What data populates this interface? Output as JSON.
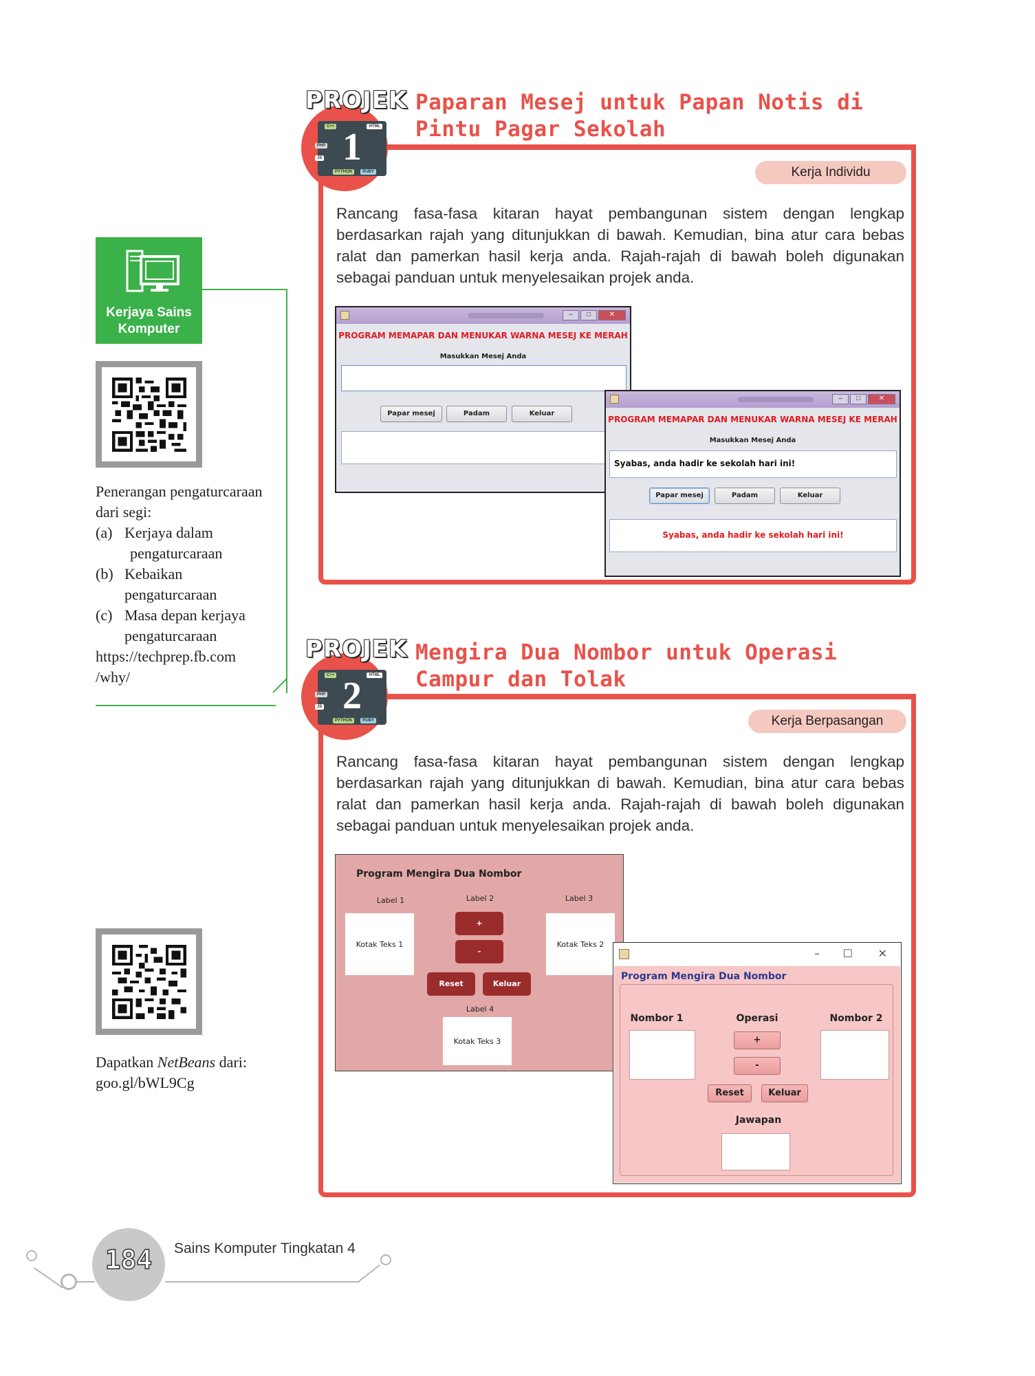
{
  "sidebar": {
    "career_badge": "Kerjaya Sains Komputer",
    "programming_note": {
      "intro_line1": "Penerangan pengaturcaraan",
      "intro_line2": "dari segi:",
      "items": [
        {
          "mark": "(a)",
          "line1": "Kerjaya dalam",
          "line2": "pengaturcaraan"
        },
        {
          "mark": "(b)",
          "line1": "Kebaikan",
          "line2": "pengaturcaraan"
        },
        {
          "mark": "(c)",
          "line1": "Masa depan kerjaya",
          "line2": "pengaturcaraan"
        }
      ],
      "url_line1": "https://techprep.fb.com",
      "url_line2": "/why/"
    },
    "netbeans_note": {
      "prefix": "Dapatkan ",
      "italic": "NetBeans",
      "suffix": " dari:",
      "url": "goo.gl/bWL9Cg"
    }
  },
  "project1": {
    "word": "PROJEK",
    "number": "1",
    "title_line1": "Paparan Mesej untuk Papan Notis di",
    "title_line2": "Pintu Pagar Sekolah",
    "work_type": "Kerja Individu",
    "description": "Rancang fasa-fasa kitaran hayat pembangunan sistem dengan lengkap berdasarkan rajah yang ditunjukkan di bawah. Kemudian, bina atur cara bebas ralat dan pamerkan hasil kerja anda. Rajah-rajah di bawah boleh digunakan sebagai panduan untuk menyelesaikan projek anda.",
    "tech_tags": [
      "C++",
      "HTML",
      "PHP",
      "JS",
      "PYTHON",
      "RUBY"
    ],
    "window": {
      "heading": "PROGRAM MEMAPAR DAN MENUKAR WARNA MESEJ KE MERAH",
      "prompt": "Masukkan Mesej Anda",
      "buttons": [
        "Papar mesej",
        "Padam",
        "Keluar"
      ],
      "input_value": "Syabas, anda hadir ke sekolah hari ini!",
      "output_value": "Syabas, anda hadir ke sekolah hari ini!"
    }
  },
  "project2": {
    "word": "PROJEK",
    "number": "2",
    "title_line1": "Mengira Dua Nombor untuk Operasi",
    "title_line2": "Campur dan Tolak",
    "work_type": "Kerja Berpasangan",
    "description": "Rancang fasa-fasa kitaran hayat pembangunan sistem dengan lengkap berdasarkan rajah yang ditunjukkan di bawah. Kemudian, bina atur cara bebas ralat dan pamerkan hasil kerja anda. Rajah-rajah di bawah boleh digunakan sebagai panduan untuk menyelesaikan projek anda.",
    "tech_tags": [
      "C++",
      "HTML",
      "PHP",
      "JS",
      "PYTHON",
      "RUBY"
    ],
    "mockup": {
      "title": "Program Mengira Dua Nombor",
      "label1": "Label 1",
      "label2": "Label 2",
      "label3": "Label 3",
      "label4": "Label 4",
      "textbox1": "Kotak Teks 1",
      "textbox2": "Kotak Teks 2",
      "textbox3": "Kotak Teks 3",
      "plus": "+",
      "minus": "-",
      "reset": "Reset",
      "exit": "Keluar"
    },
    "app": {
      "title": "Program Mengira Dua Nombor",
      "number1": "Nombor 1",
      "operation": "Operasi",
      "number2": "Nombor 2",
      "plus": "+",
      "minus": "-",
      "reset": "Reset",
      "exit": "Keluar",
      "answer": "Jawapan"
    }
  },
  "footer": {
    "page_number": "184",
    "book_title": "Sains Komputer Tingkatan 4"
  },
  "colors": {
    "accent_red": "#e8524a",
    "career_green": "#3bb14a",
    "pill_pink": "#f6c9c0"
  }
}
